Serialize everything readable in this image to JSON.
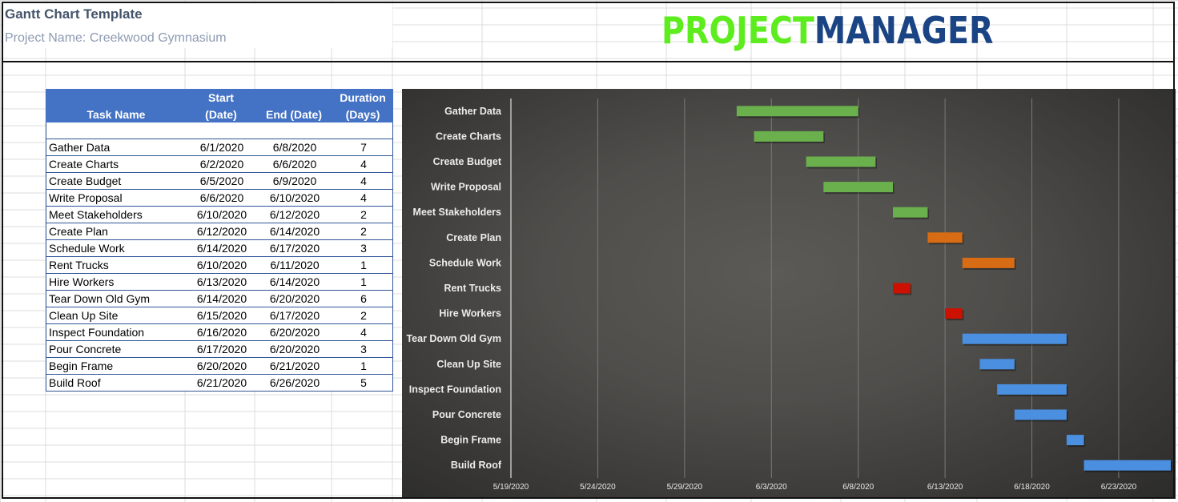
{
  "header": {
    "title": "Gantt Chart Template",
    "project_name": "Project Name: Creekwood Gymnasium",
    "logo_part1": "PROJECT",
    "logo_part2": "MANAGER",
    "logo_color1": "#5ded1e",
    "logo_color2": "#1a4483"
  },
  "table": {
    "header_color": "#4472c4",
    "columns": [
      {
        "line1": "",
        "line2": "Task Name"
      },
      {
        "line1": "Start",
        "line2": "(Date)"
      },
      {
        "line1": "",
        "line2": "End  (Date)"
      },
      {
        "line1": "Duration",
        "line2": "(Days)"
      }
    ],
    "rows": [
      {
        "task": "Gather Data",
        "start": "6/1/2020",
        "end": "6/8/2020",
        "duration": "7"
      },
      {
        "task": "Create Charts",
        "start": "6/2/2020",
        "end": "6/6/2020",
        "duration": "4"
      },
      {
        "task": "Create Budget",
        "start": "6/5/2020",
        "end": "6/9/2020",
        "duration": "4"
      },
      {
        "task": "Write Proposal",
        "start": "6/6/2020",
        "end": "6/10/2020",
        "duration": "4"
      },
      {
        "task": "Meet Stakeholders",
        "start": "6/10/2020",
        "end": "6/12/2020",
        "duration": "2"
      },
      {
        "task": "Create Plan",
        "start": "6/12/2020",
        "end": "6/14/2020",
        "duration": "2"
      },
      {
        "task": "Schedule Work",
        "start": "6/14/2020",
        "end": "6/17/2020",
        "duration": "3"
      },
      {
        "task": "Rent Trucks",
        "start": "6/10/2020",
        "end": "6/11/2020",
        "duration": "1"
      },
      {
        "task": "Hire Workers",
        "start": "6/13/2020",
        "end": "6/14/2020",
        "duration": "1"
      },
      {
        "task": "Tear Down Old Gym",
        "start": "6/14/2020",
        "end": "6/20/2020",
        "duration": "6"
      },
      {
        "task": "Clean Up Site",
        "start": "6/15/2020",
        "end": "6/17/2020",
        "duration": "2"
      },
      {
        "task": "Inspect Foundation",
        "start": "6/16/2020",
        "end": "6/20/2020",
        "duration": "4"
      },
      {
        "task": "Pour Concrete",
        "start": "6/17/2020",
        "end": "6/20/2020",
        "duration": "3"
      },
      {
        "task": "Begin Frame",
        "start": "6/20/2020",
        "end": "6/21/2020",
        "duration": "1"
      },
      {
        "task": "Build Roof",
        "start": "6/21/2020",
        "end": "6/26/2020",
        "duration": "5"
      }
    ]
  },
  "chart_data": {
    "type": "bar",
    "subtype": "gantt",
    "title": "",
    "xlabel": "",
    "ylabel": "",
    "orientation": "horizontal",
    "categories": [
      "Gather Data",
      "Create Charts",
      "Create Budget",
      "Write Proposal",
      "Meet Stakeholders",
      "Create Plan",
      "Schedule Work",
      "Rent Trucks",
      "Hire Workers",
      "Tear Down Old Gym",
      "Clean Up Site",
      "Inspect Foundation",
      "Pour Concrete",
      "Begin Frame",
      "Build Roof"
    ],
    "series": [
      {
        "name": "Start Date",
        "values": [
          "2020-06-01",
          "2020-06-02",
          "2020-06-05",
          "2020-06-06",
          "2020-06-10",
          "2020-06-12",
          "2020-06-14",
          "2020-06-10",
          "2020-06-13",
          "2020-06-14",
          "2020-06-15",
          "2020-06-16",
          "2020-06-17",
          "2020-06-20",
          "2020-06-21"
        ],
        "visible": false
      },
      {
        "name": "Duration (Days)",
        "values": [
          7,
          4,
          4,
          4,
          2,
          2,
          3,
          1,
          1,
          6,
          2,
          4,
          3,
          1,
          5
        ]
      }
    ],
    "bar_colors": [
      "#6ab04c",
      "#6ab04c",
      "#6ab04c",
      "#6ab04c",
      "#6ab04c",
      "#d86c14",
      "#d86c14",
      "#cc1100",
      "#cc1100",
      "#4a8fe0",
      "#4a8fe0",
      "#4a8fe0",
      "#4a8fe0",
      "#4a8fe0",
      "#4a8fe0"
    ],
    "x_ticks": [
      "5/19/2020",
      "5/24/2020",
      "5/29/2020",
      "6/3/2020",
      "6/8/2020",
      "6/13/2020",
      "6/18/2020",
      "6/23/2020"
    ],
    "xlim": [
      "2020-05-19",
      "2020-06-26"
    ],
    "x_tick_step_days": 5,
    "grid": true,
    "legend": "none",
    "background": "dark-gradient"
  }
}
